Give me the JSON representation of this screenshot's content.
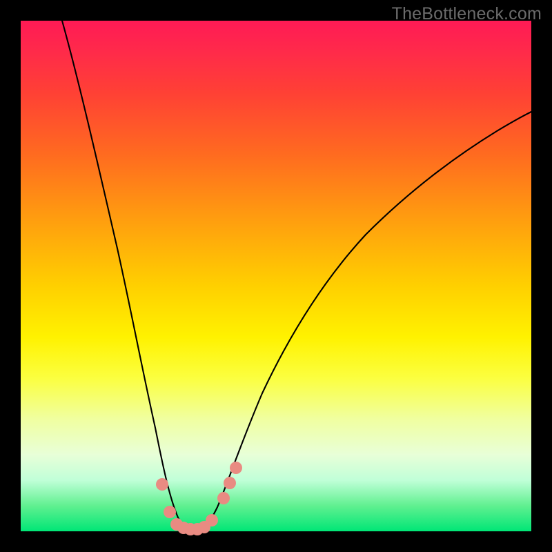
{
  "watermark": "TheBottleneck.com",
  "chart_data": {
    "type": "line",
    "title": "",
    "xlabel": "",
    "ylabel": "",
    "xlim": [
      0,
      100
    ],
    "ylim": [
      0,
      100
    ],
    "grid": false,
    "legend": false,
    "series": [
      {
        "name": "bottleneck-curve",
        "x": [
          8,
          10,
          12,
          14,
          16,
          18,
          20,
          22,
          24,
          26,
          27,
          28,
          29,
          30,
          31,
          32,
          33,
          34,
          35,
          36,
          38,
          40,
          44,
          48,
          52,
          56,
          60,
          66,
          72,
          80,
          88,
          96,
          100
        ],
        "y": [
          100,
          92,
          84,
          76,
          68,
          60,
          52,
          44,
          36,
          26,
          20,
          14,
          8,
          4,
          1,
          0.5,
          1,
          4,
          8,
          14,
          22,
          30,
          42,
          50,
          56,
          61,
          65,
          70,
          74,
          79,
          83,
          87,
          89
        ]
      }
    ],
    "highlight_points": {
      "name": "marker-dots",
      "color": "#e98b82",
      "x": [
        25.5,
        27.5,
        29,
        30,
        31,
        32,
        33,
        34.5,
        36.5,
        37.5,
        38.5
      ],
      "y": [
        10,
        4,
        1.2,
        0.8,
        0.6,
        0.6,
        0.8,
        1.4,
        7,
        10,
        13
      ]
    },
    "background_gradient": {
      "top": "#ff1a55",
      "mid": "#fff200",
      "bottom": "#00e676"
    }
  }
}
